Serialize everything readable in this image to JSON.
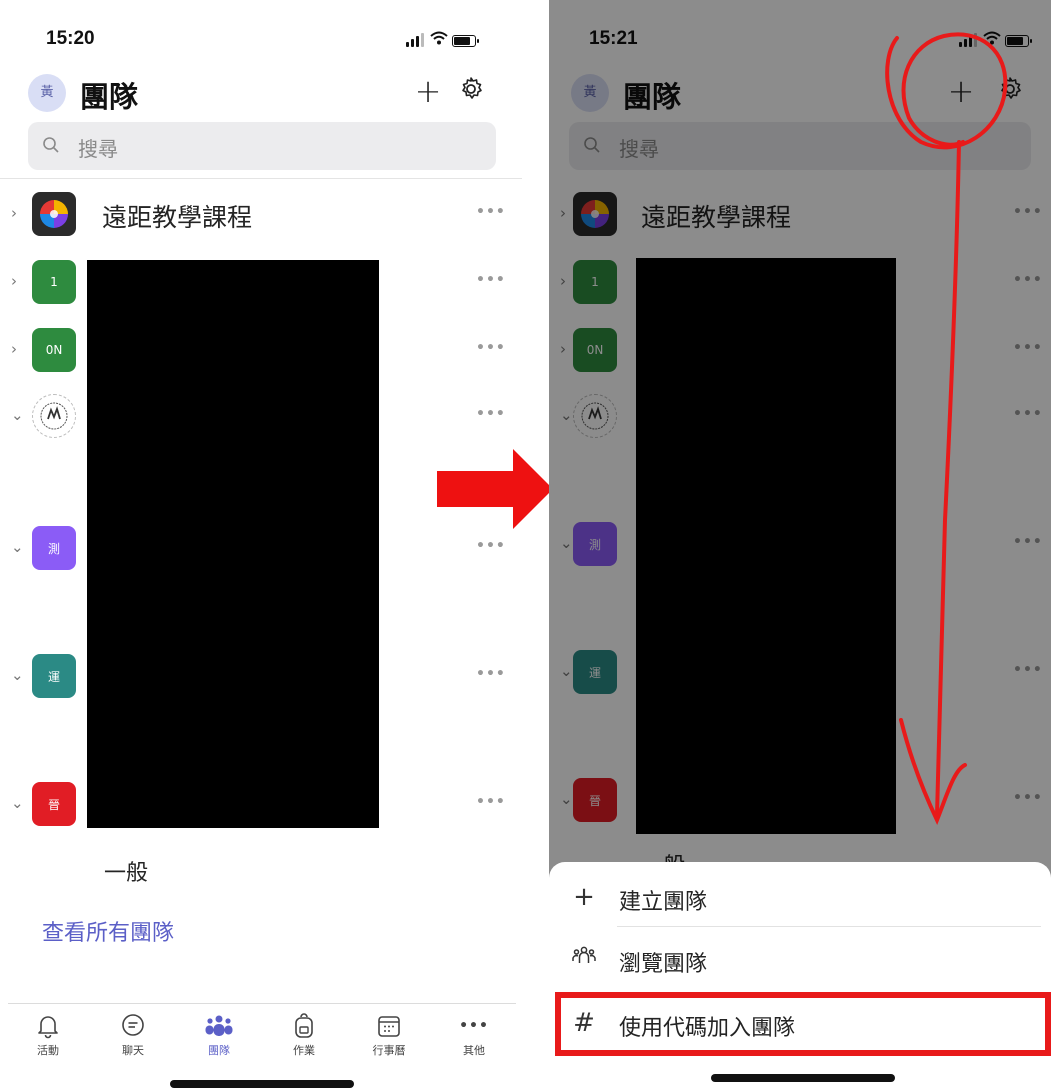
{
  "left": {
    "status": {
      "time": "15:20"
    },
    "header": {
      "avatar_initial": "黃",
      "title": "團隊"
    },
    "search": {
      "placeholder": "搜尋"
    },
    "teams": [
      {
        "label": "遠距教學課程",
        "tile_text": "",
        "tile_icon": "color-wheel-icon"
      },
      {
        "label": "",
        "tile_text": "1",
        "tile_color": "#2e8b3f"
      },
      {
        "label": "",
        "tile_text": "0N",
        "tile_color": "#2e8b3f"
      },
      {
        "label": "",
        "tile_text": "",
        "tile_icon": "seal-icon"
      },
      {
        "label": "",
        "tile_text": "測",
        "tile_color": "#8b5cf6"
      },
      {
        "label": "",
        "tile_text": "運",
        "tile_color": "#2b8a85"
      },
      {
        "label": "",
        "tile_text": "晉",
        "tile_color": "#e11d25"
      }
    ],
    "channel": "一般",
    "see_all": "查看所有團隊",
    "tabs": [
      {
        "label": "活動",
        "icon": "bell-icon"
      },
      {
        "label": "聊天",
        "icon": "chat-icon"
      },
      {
        "label": "團隊",
        "icon": "teams-icon",
        "active": true
      },
      {
        "label": "作業",
        "icon": "backpack-icon"
      },
      {
        "label": "行事曆",
        "icon": "calendar-icon"
      },
      {
        "label": "其他",
        "icon": "more-icon"
      }
    ]
  },
  "right": {
    "status": {
      "time": "15:21"
    },
    "header": {
      "avatar_initial": "黃",
      "title": "團隊"
    },
    "search": {
      "placeholder": "搜尋"
    },
    "teams_first_label": "遠距教學課程",
    "channel": "一般",
    "menu": [
      {
        "label": "建立團隊",
        "icon": "plus-icon"
      },
      {
        "label": "瀏覽團隊",
        "icon": "people-icon"
      },
      {
        "label": "使用代碼加入團隊",
        "icon": "hash-icon"
      }
    ]
  },
  "colors": {
    "accent": "#5b5fc7",
    "annotation": "#e81a1a"
  }
}
